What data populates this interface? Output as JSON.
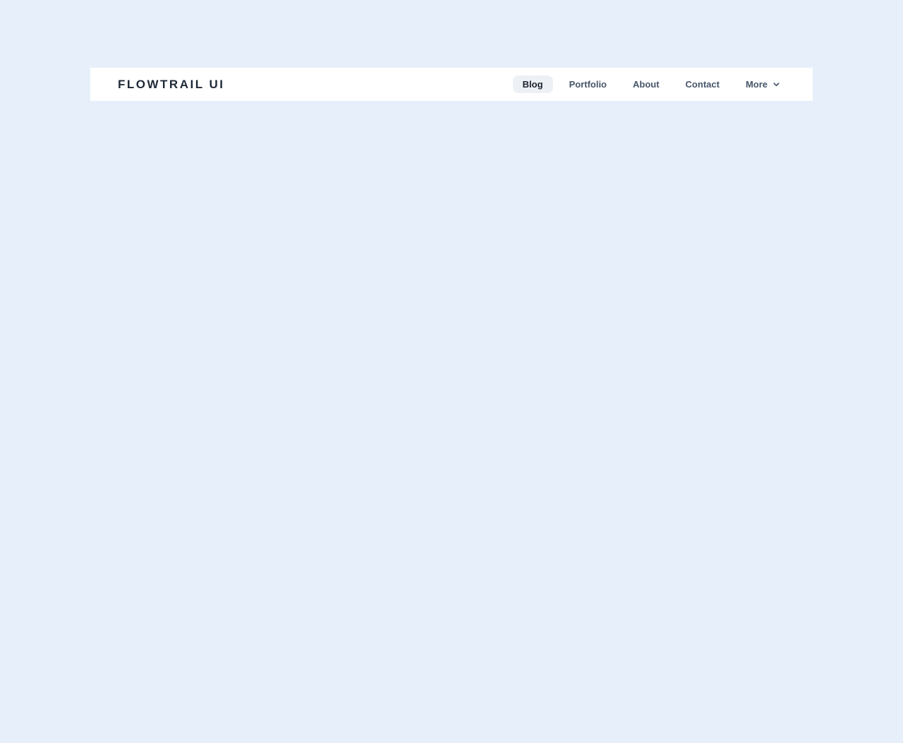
{
  "page": {
    "background_color": "#e7f0fa"
  },
  "header": {
    "logo_text": "FLOWTRAIL UI",
    "nav_items": [
      {
        "label": "Blog",
        "active": true
      },
      {
        "label": "Portfolio",
        "active": false
      },
      {
        "label": "About",
        "active": false
      },
      {
        "label": "Contact",
        "active": false
      },
      {
        "label": "More",
        "active": false,
        "has_dropdown": true
      }
    ],
    "icons": {
      "more_dropdown": "chevron-down-icon"
    },
    "colors": {
      "bar_background": "#ffffff",
      "active_item_background": "#edf0f5",
      "active_item_text": "#1b212c",
      "item_text": "#475569",
      "logo_text": "#1f2937"
    }
  }
}
